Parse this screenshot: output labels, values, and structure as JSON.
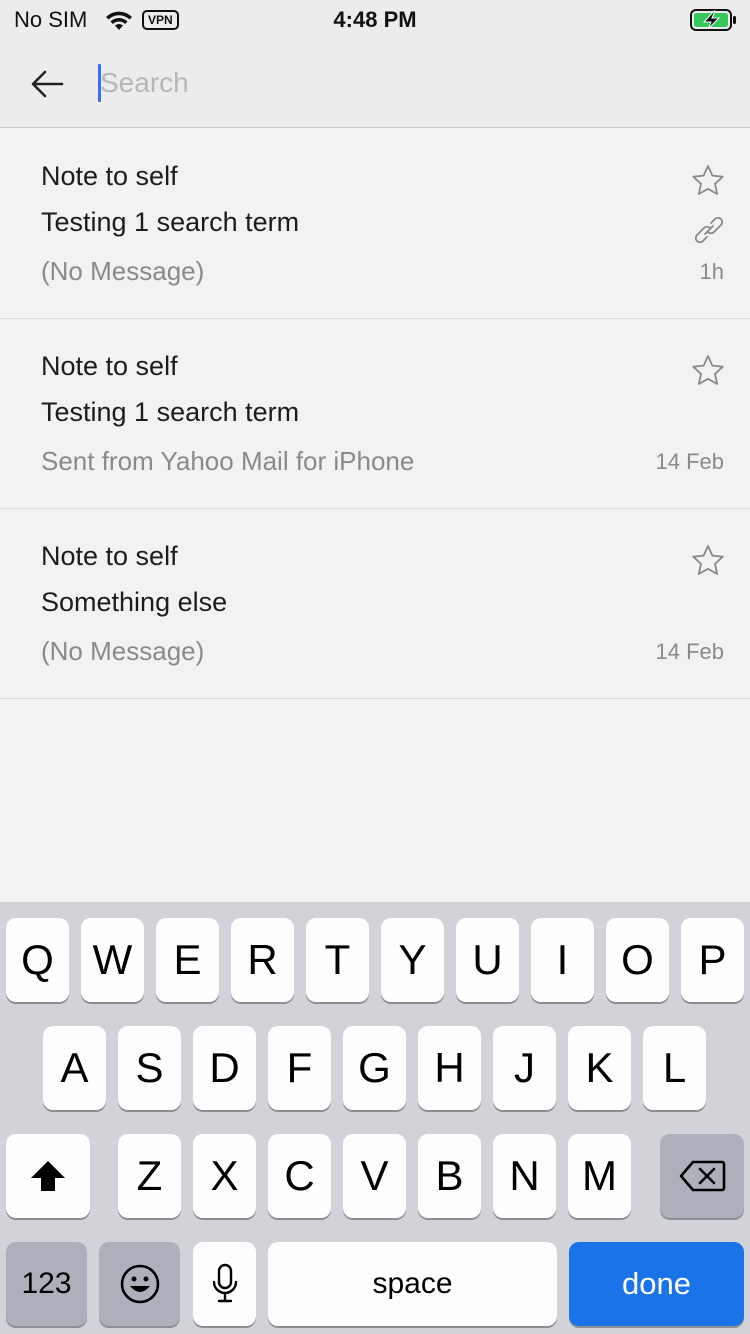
{
  "status_bar": {
    "carrier": "No SIM",
    "vpn": "VPN",
    "time": "4:48 PM"
  },
  "search": {
    "placeholder": "Search",
    "value": ""
  },
  "results": [
    {
      "sender": "Note to self",
      "subject": "Testing 1 search term",
      "preview": "(No Message)",
      "date": "1h",
      "starred": false,
      "has_attachment": true
    },
    {
      "sender": "Note to self",
      "subject": "Testing 1 search term",
      "preview": "Sent from Yahoo Mail for iPhone",
      "date": "14 Feb",
      "starred": false,
      "has_attachment": false
    },
    {
      "sender": "Note to self",
      "subject": "Something else",
      "preview": "(No Message)",
      "date": "14 Feb",
      "starred": false,
      "has_attachment": false
    }
  ],
  "keyboard": {
    "row1": [
      "Q",
      "W",
      "E",
      "R",
      "T",
      "Y",
      "U",
      "I",
      "O",
      "P"
    ],
    "row2": [
      "A",
      "S",
      "D",
      "F",
      "G",
      "H",
      "J",
      "K",
      "L"
    ],
    "row3": [
      "Z",
      "X",
      "C",
      "V",
      "B",
      "N",
      "M"
    ],
    "numbers_label": "123",
    "space_label": "space",
    "done_label": "done"
  },
  "colors": {
    "accent": "#1a73e8",
    "cursor": "#3d6bff",
    "battery_green": "#34c759"
  }
}
